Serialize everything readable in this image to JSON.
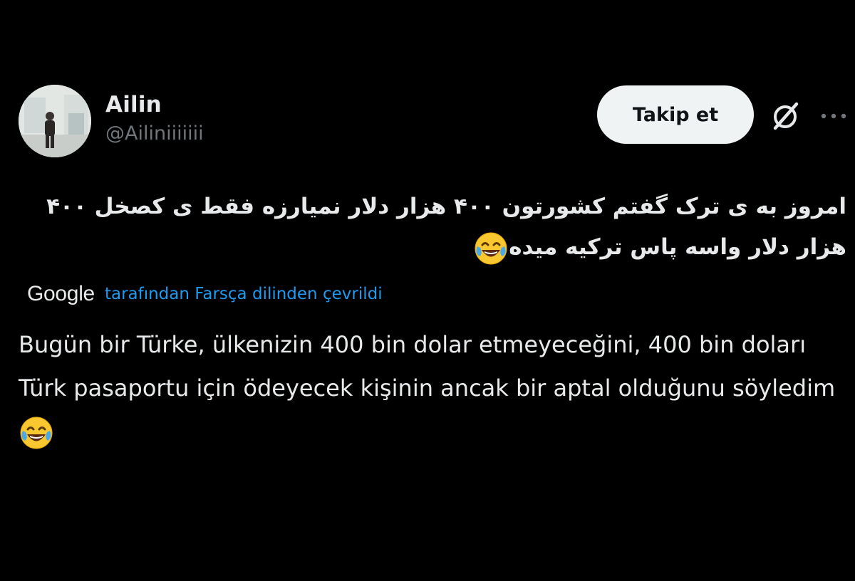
{
  "colors": {
    "background": "#000000",
    "text_primary": "#e7e9ea",
    "text_secondary": "#71767b",
    "link": "#1d9bf0",
    "follow_button_bg": "#eff3f4",
    "follow_button_text": "#0f1419"
  },
  "author": {
    "display_name": "Ailin",
    "handle": "@Ailiniiiiiii",
    "avatar": "profile-photo"
  },
  "actions": {
    "follow_label": "Takip et",
    "grok_icon": "grok-slash-circle-icon",
    "more_icon": "more-horizontal-icon"
  },
  "tweet": {
    "original_text": "امروز به ی ترک گفتم کشورتون ۴۰۰ هزار دلار نمیارزه فقط ی کصخل ۴۰۰ هزار دلار واسه پاس ترکیه میده",
    "original_emoji": "face-with-tears-of-joy-emoji",
    "translation_provider": "Google",
    "translation_label": "tarafından Farsça dilinden çevrildi",
    "translated_text": "Bugün bir Türke, ülkenizin 400 bin dolar etmeyeceğini, 400 bin doları Türk pasaportu için ödeyecek kişinin ancak bir aptal olduğunu söyledim",
    "translated_emoji": "face-with-tears-of-joy-emoji"
  }
}
